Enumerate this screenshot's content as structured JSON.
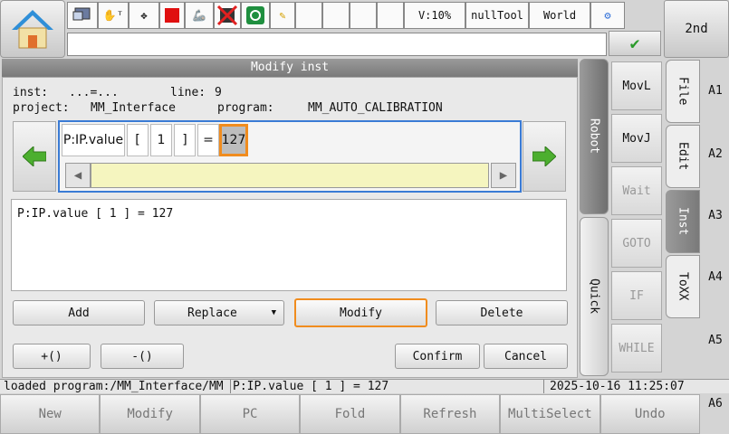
{
  "toolbar": {
    "speed": "V:10%",
    "tool": "nullTool",
    "frame": "World"
  },
  "second": "2nd",
  "panel": {
    "title": "Modify inst",
    "inst_label": "inst:",
    "inst_value": "...=...",
    "line_label": "line:",
    "line_value": "9",
    "project_label": "project:",
    "project_value": "MM_Interface",
    "program_label": "program:",
    "program_value": "MM_AUTO_CALIBRATION"
  },
  "tokens": [
    "P:IP.value",
    "[",
    "1",
    "]",
    "=",
    "127"
  ],
  "preview": "P:IP.value [ 1 ] = 127",
  "actions": {
    "add": "Add",
    "replace": "Replace",
    "modify": "Modify",
    "delete": "Delete",
    "plus_paren": "+()",
    "minus_paren": "-()",
    "confirm": "Confirm",
    "cancel": "Cancel"
  },
  "side_tabs": {
    "robot": "Robot",
    "quick": "Quick"
  },
  "inst_buttons": [
    "MovL",
    "MovJ",
    "Wait",
    "GOTO",
    "IF",
    "WHILE"
  ],
  "right_tabs": [
    "File",
    "Edit",
    "Inst",
    "ToXX"
  ],
  "right_labels": [
    "A1",
    "A2",
    "A3",
    "A4",
    "A5",
    "A6"
  ],
  "status": {
    "message": "loaded program:/MM_Interface/MM",
    "current": "P:IP.value [ 1 ] = 127",
    "datetime": "2025-10-16 11:25:07"
  },
  "bottom": [
    "New",
    "Modify",
    "PC",
    "Fold",
    "Refresh",
    "MultiSelect",
    "Undo"
  ],
  "colors": {
    "highlight": "#f08c1e",
    "selection_border": "#3a7bd5",
    "arrow_green": "#4caf2f"
  }
}
